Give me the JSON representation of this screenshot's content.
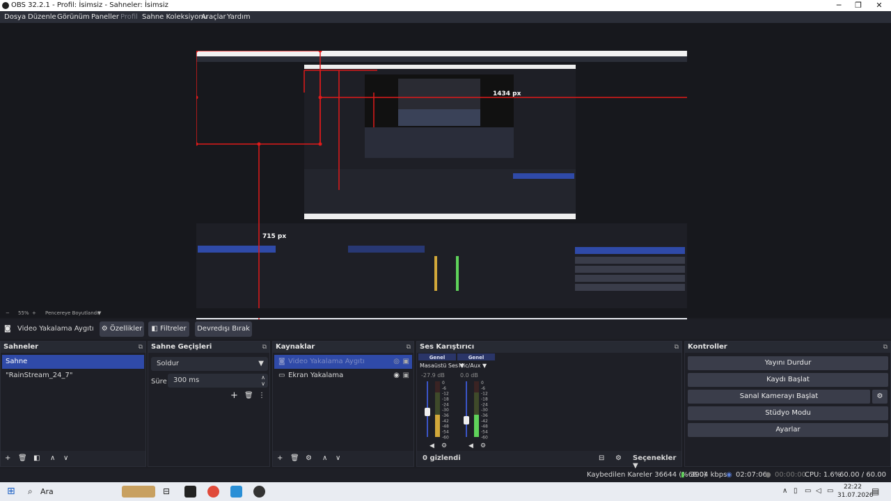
{
  "window": {
    "title": "OBS 32.2.1 - Profil: İsimsiz - Sahneler: İsimsiz"
  },
  "menu": {
    "items": [
      "Dosya",
      "Düzenle",
      "Görünüm",
      "Paneller",
      "Profil",
      "Sahne Koleksiyonu",
      "Araçlar",
      "Yardım"
    ]
  },
  "preview": {
    "measure_h": "1434 px",
    "measure_v": "715 px",
    "zoom": "55%",
    "fit_label": "Pencereye Boyutlandır"
  },
  "source_toolbar": {
    "source_name": "Video Yakalama Aygıtı",
    "properties": "Özellikler",
    "filters": "Filtreler",
    "deactivate": "Devredışı Bırak"
  },
  "scenes": {
    "title": "Sahneler",
    "items": [
      "Sahne",
      "\"RainStream_24_7\""
    ]
  },
  "transitions": {
    "title": "Sahne Geçişleri",
    "selected": "Soldur",
    "duration_label": "Süre",
    "duration_value": "300 ms"
  },
  "sources": {
    "title": "Kaynaklar",
    "items": [
      "Video Yakalama Aygıtı",
      "Ekran Yakalama"
    ]
  },
  "mixer": {
    "title": "Ses Karıştırıcı",
    "channels": [
      {
        "tag": "Genel",
        "name": "Masaüstü Ses",
        "db": "-27.9 dB",
        "level": 0.45,
        "color": "#d2a83a"
      },
      {
        "tag": "Genel",
        "name": "Mic/Aux",
        "db": "0.0 dB",
        "level": 0.3,
        "color": "#5fd35a"
      }
    ],
    "scale": [
      "0",
      "-6",
      "-12",
      "-18",
      "-24",
      "-30",
      "-36",
      "-42",
      "-48",
      "-54",
      "-60"
    ],
    "hidden": "0 gizlendi",
    "options": "Seçenekler"
  },
  "controls": {
    "title": "Kontroller",
    "start_stream": "Yayını Durdur",
    "start_record": "Kaydı Başlat",
    "virtual_cam": "Sanal Kamerayı Başlat",
    "studio_mode": "Stüdyo Modu",
    "settings": "Ayarlar"
  },
  "status": {
    "dropped": "Kaybedilen Kareler 36644 (%68.0)",
    "bitrate": "3904 kbps",
    "stream_time": "02:07:06",
    "rec_time": "00:00:00",
    "cpu": "CPU: 1.6%",
    "fps": "60.00 / 60.00 FPS"
  },
  "taskbar": {
    "search": "Ara",
    "time": "22:22",
    "date": "31.07.2026"
  },
  "colors": {
    "accent": "#2f4aa8",
    "measure": "#e01a1a"
  }
}
